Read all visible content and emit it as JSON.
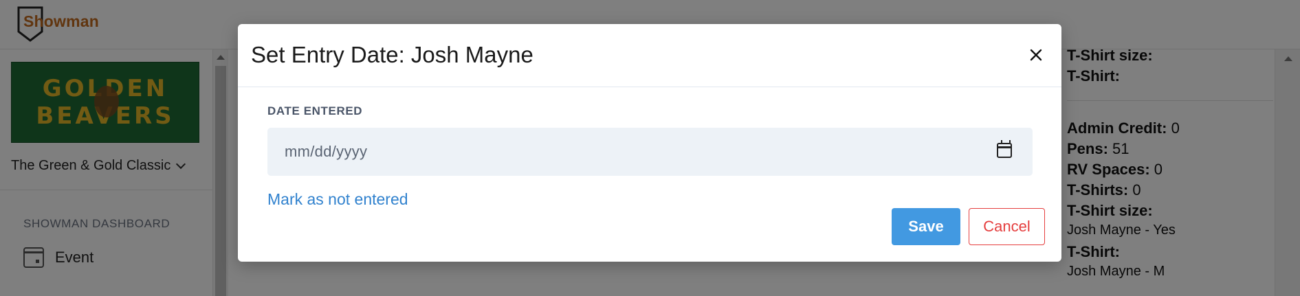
{
  "app": {
    "logo_text": "Showman"
  },
  "sidebar": {
    "banner_line1": "GOLDEN",
    "banner_line2": "BEAVERS",
    "event_name": "The Green & Gold Classic",
    "section_title": "SHOWMAN DASHBOARD",
    "items": [
      {
        "label": "Event",
        "icon": "calendar-icon"
      }
    ]
  },
  "details": {
    "tshirt_size_label": "T-Shirt size:",
    "tshirt_label": "T-Shirt:",
    "admin_credit_label": "Admin Credit:",
    "admin_credit_value": "0",
    "pens_label": "Pens:",
    "pens_value": "51",
    "rv_label": "RV Spaces:",
    "rv_value": "0",
    "tshirts_label": "T-Shirts:",
    "tshirts_value": "0",
    "tshirt_size_label2": "T-Shirt size:",
    "tshirt_size_value": "Josh Mayne - Yes",
    "tshirt_label2": "T-Shirt:",
    "tshirt_value": "Josh Mayne - M"
  },
  "modal": {
    "title": "Set Entry Date: Josh Mayne",
    "close_icon": "close-icon",
    "field_label": "DATE ENTERED",
    "date_placeholder": "mm/dd/yyyy",
    "mark_link": "Mark as not entered",
    "save_label": "Save",
    "cancel_label": "Cancel"
  },
  "colors": {
    "primary": "#4299e1",
    "link": "#3182ce",
    "danger": "#e53e3e",
    "input_bg": "#edf2f7",
    "banner_green": "#1f6b35",
    "banner_gold": "#e5b728"
  }
}
